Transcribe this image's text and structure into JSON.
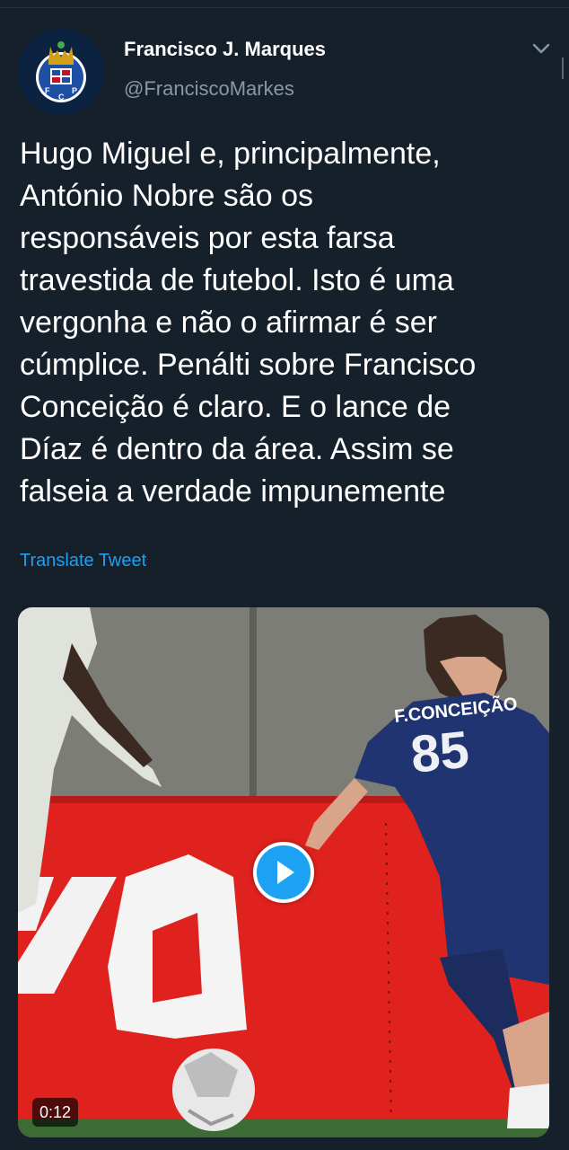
{
  "user": {
    "display_name": "Francisco J. Marques",
    "handle": "@FranciscoMarkes",
    "avatar_icon": "fc-porto-crest-icon"
  },
  "tweet": {
    "lines": [
      "Hugo Miguel e, principalmente,",
      "António Nobre são os",
      "responsáveis por esta farsa",
      "travestida de futebol. Isto é uma",
      "vergonha e não o afirmar é ser",
      "cúmplice. Penálti sobre Francisco",
      "Conceição é claro. E o lance de",
      "Díaz é dentro da área. Assim se",
      "falseia a verdade impunemente"
    ],
    "translate_label": "Translate Tweet"
  },
  "media": {
    "type": "video",
    "duration": "0:12",
    "play_icon": "play-icon",
    "jersey_name": "F.CONCEIÇÃO",
    "jersey_number": "85"
  },
  "colors": {
    "background": "#15202b",
    "text": "#ffffff",
    "secondary": "#8899a6",
    "accent": "#1da1f2"
  }
}
